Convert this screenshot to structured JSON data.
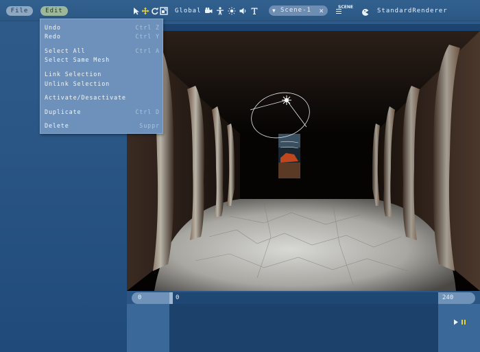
{
  "topbar": {
    "file_label": "File",
    "edit_label": "Edit",
    "tools": [
      "select-arrow-icon",
      "move-icon",
      "rotate-icon",
      "scale-icon"
    ],
    "space_label": "Global",
    "add_tools": [
      "camera-icon",
      "character-icon",
      "light-icon",
      "sound-icon",
      "text-icon"
    ],
    "scene": {
      "name": "Scene-1",
      "close_glyph": "✕",
      "arrow_glyph": "▼"
    },
    "scene_tag": "SCENE",
    "renderer_label": "StandardRenderer"
  },
  "edit_menu": {
    "items": [
      {
        "label": "Undo",
        "shortcut": "Ctrl Z"
      },
      {
        "label": "Redo",
        "shortcut": "Ctrl Y"
      },
      {
        "label": "Select All",
        "shortcut": "Ctrl A"
      },
      {
        "label": "Select Same Mesh",
        "shortcut": ""
      },
      {
        "label": "Link Selection",
        "shortcut": ""
      },
      {
        "label": "Unlink Selection",
        "shortcut": ""
      },
      {
        "label": "Activate/Desactivate",
        "shortcut": ""
      },
      {
        "label": "Duplicate",
        "shortcut": "Ctrl D"
      },
      {
        "label": "Delete",
        "shortcut": "Suppr"
      }
    ]
  },
  "timeline": {
    "start": "0",
    "current": "0",
    "end": "240",
    "progress": 0
  },
  "colors": {
    "background": "#2a5686",
    "menu_bg": "#6d91ba",
    "edit_pill": "#9cb79a",
    "accent_yellow": "#e6d23a"
  }
}
